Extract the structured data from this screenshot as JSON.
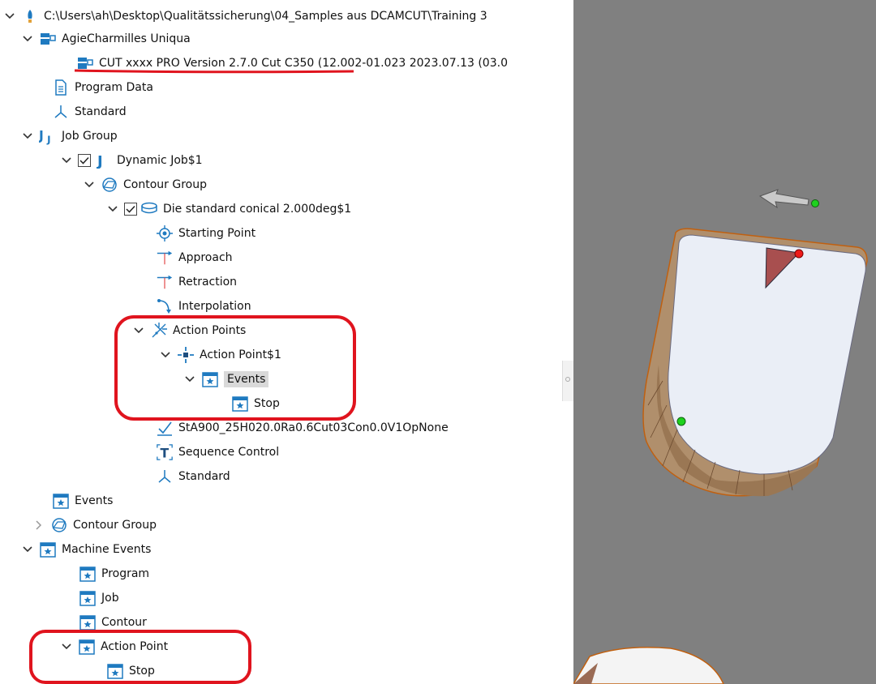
{
  "tree": {
    "root_path": "C:\\Users\\ah\\Desktop\\Qualitätssicherung\\04_Samples aus DCAMCUT\\Training 3",
    "machine": "AgieCharmilles Uniqua",
    "version": "CUT xxxx PRO Version 2.7.0 Cut C350 (12.002-01.023 2023.07.13 (03.0",
    "program_data": "Program Data",
    "standard": "Standard",
    "job_group": "Job Group",
    "dynamic_job": "Dynamic Job$1",
    "contour_group": "Contour Group",
    "die_conical": "Die standard conical 2.000deg$1",
    "starting_point": "Starting Point",
    "approach": "Approach",
    "retraction": "Retraction",
    "interpolation": "Interpolation",
    "action_points": "Action Points",
    "action_point1": "Action Point$1",
    "events": "Events",
    "stop": "Stop",
    "technology": "StA900_25H020.0Ra0.6Cut03Con0.0V1OpNone",
    "sequence_control": "Sequence Control",
    "standard2": "Standard",
    "events_top": "Events",
    "contour_group2": "Contour Group",
    "machine_events": "Machine Events",
    "program": "Program",
    "job": "Job",
    "contour": "Contour",
    "action_point": "Action Point",
    "stop2": "Stop"
  },
  "colors": {
    "icon_blue": "#1f7ac0",
    "annotation_red": "#e0141e",
    "viewport_bg": "#808080"
  }
}
